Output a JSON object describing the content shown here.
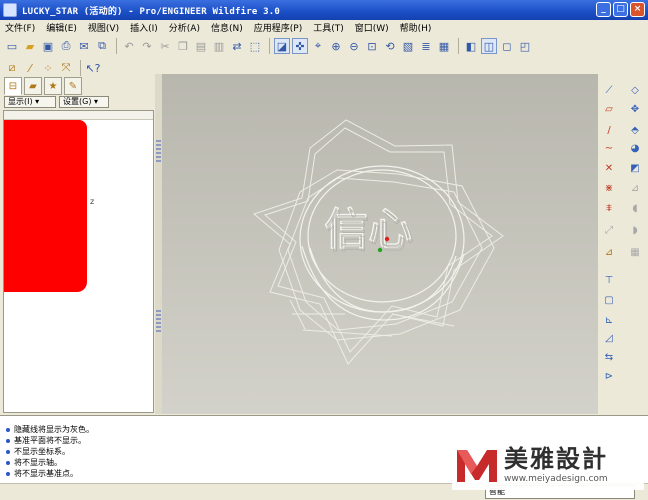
{
  "window": {
    "title": "LUCKY_STAR (活动的) - Pro/ENGINEER Wildfire 3.0",
    "minimize": "_",
    "maximize": "□",
    "close": "×"
  },
  "menu": [
    "文件(F)",
    "编辑(E)",
    "视图(V)",
    "插入(I)",
    "分析(A)",
    "信息(N)",
    "应用程序(P)",
    "工具(T)",
    "窗口(W)",
    "帮助(H)"
  ],
  "toolbar1": [
    "new-icon",
    "open-icon",
    "save-icon",
    "print-icon",
    "email-icon",
    "copy-link-icon",
    "sep",
    "undo-icon",
    "redo-icon",
    "cut-icon",
    "copy-icon",
    "paste-icon",
    "paste-special-icon",
    "regenerate-icon",
    "select-box-icon",
    "sep",
    "repaint-icon",
    "spin-center-icon",
    "orient-icon",
    "zoom-in-icon",
    "zoom-out-icon",
    "refit-icon",
    "reorient-icon",
    "saved-views-icon",
    "layers-icon",
    "view-manager-icon",
    "sep",
    "shading-icon",
    "hidden-line-icon",
    "no-hidden-icon",
    "wireframe-icon"
  ],
  "toolbar2": [
    "datum-plane-display-icon",
    "datum-axis-display-icon",
    "point-display-icon",
    "csys-display-icon",
    "sep",
    "context-help-icon"
  ],
  "nav_tabs": [
    "model-tree-tab",
    "folder-browser-tab",
    "favorites-tab",
    "connections-tab"
  ],
  "model_tree": {
    "show_button": "显示(I) ▾",
    "settings_button": "设置(G) ▾",
    "tree_mark": "z"
  },
  "graphics": {
    "embossed_text": "信心"
  },
  "messages": [
    "隐藏线将显示为灰色。",
    "基准平面将不显示。",
    "不显示坐标系。",
    "将不显示轴。",
    "将不显示基准点。"
  ],
  "status": {
    "filter": "智能"
  },
  "watermark": {
    "name": "美雅設計",
    "url": "www.meiyadesign.com"
  },
  "colors": {
    "title_bar": "#1b4fc6",
    "highlight_red": "#ff0000",
    "graphics_bg": "#c4c3ba"
  }
}
